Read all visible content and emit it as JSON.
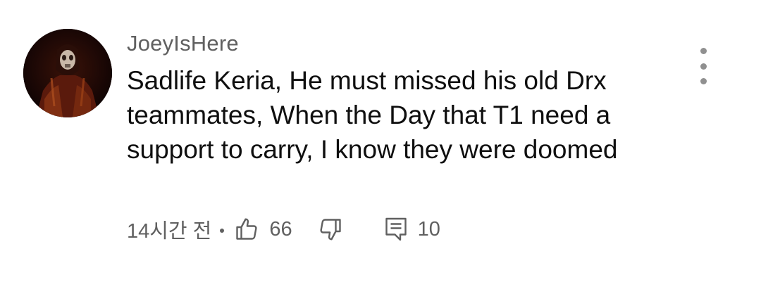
{
  "comment": {
    "author": "JoeyIsHere",
    "text": "Sadlife Keria, He must missed his old Drx teammates, When the Day that T1 need a support to carry, I know they were doomed",
    "time": "14시간 전",
    "likes": "66",
    "replies": "10"
  },
  "icons": {
    "avatar": "avatar",
    "like": "thumbs-up-icon",
    "dislike": "thumbs-down-icon",
    "reply": "comment-icon",
    "menu": "more-vertical-icon"
  },
  "colors": {
    "text": "#0f0f0f",
    "secondary": "#606060",
    "menu": "#909090"
  }
}
